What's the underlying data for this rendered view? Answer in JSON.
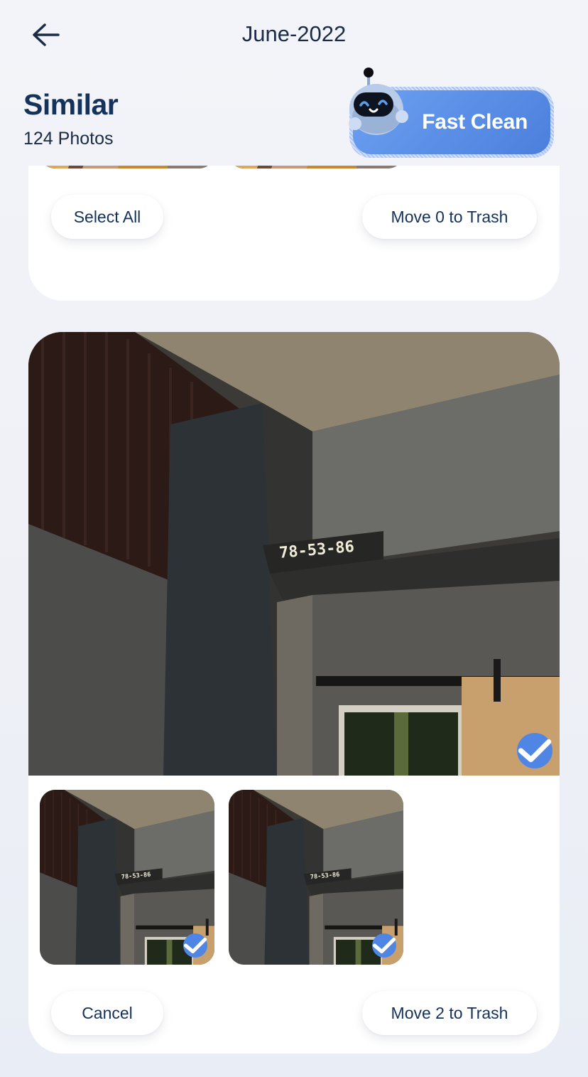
{
  "header": {
    "back_icon": "arrow-left-icon",
    "title": "June-2022"
  },
  "section": {
    "title": "Similar",
    "count": "124 Photos"
  },
  "fast_clean": {
    "label": "Fast Clean",
    "mascot_icon": "robot-mascot-icon",
    "colors": {
      "from": "#6da1f2",
      "to": "#4c7fdc"
    }
  },
  "groups": [
    {
      "photos": [
        {
          "subject": "arm-on-wooden-table",
          "selected": false
        },
        {
          "subject": "arm-on-wooden-table",
          "selected": false
        }
      ],
      "actions": {
        "left": "Select All",
        "right": "Move 0 to Trash"
      }
    },
    {
      "hero": {
        "subject": "room-corner-sign",
        "sign_text": "78-53-86",
        "selected": true
      },
      "photos": [
        {
          "subject": "room-corner-sign",
          "sign_text": "78-53-86",
          "selected": true
        },
        {
          "subject": "room-corner-sign",
          "sign_text": "78-53-86",
          "selected": true
        }
      ],
      "actions": {
        "left": "Cancel",
        "right": "Move 2 to Trash"
      }
    }
  ],
  "colors": {
    "accent": "#4f86e6",
    "text_primary": "#15325a",
    "background": "#f1f2f8",
    "card": "#ffffff"
  }
}
